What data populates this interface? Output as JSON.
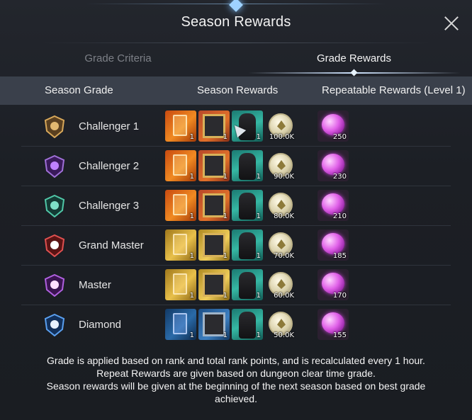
{
  "title": "Season Rewards",
  "tabs": [
    {
      "label": "Grade Criteria",
      "active": false
    },
    {
      "label": "Grade Rewards",
      "active": true
    }
  ],
  "headers": {
    "grade": "Season Grade",
    "rewards": "Season Rewards",
    "repeatable": "Repeatable Rewards (Level 1)"
  },
  "rows": [
    {
      "grade": "Challenger 1",
      "badge_color": "#b0843a",
      "item1": "1",
      "item2": "1",
      "item3": "1",
      "gold": "100.0K",
      "orbs": "250"
    },
    {
      "grade": "Challenger 2",
      "badge_color": "#7b3ab8",
      "item1": "1",
      "item2": "1",
      "item3": "1",
      "gold": "90.0K",
      "orbs": "230"
    },
    {
      "grade": "Challenger 3",
      "badge_color": "#2a9a82",
      "item1": "1",
      "item2": "1",
      "item3": "1",
      "gold": "80.0K",
      "orbs": "210"
    },
    {
      "grade": "Grand Master",
      "badge_color": "#b02a2a",
      "item1": "1",
      "item2": "1",
      "item3": "1",
      "gold": "70.0K",
      "orbs": "185"
    },
    {
      "grade": "Master",
      "badge_color": "#7a2a9a",
      "item1": "1",
      "item2": "1",
      "item3": "1",
      "gold": "60.0K",
      "orbs": "170"
    },
    {
      "grade": "Diamond",
      "badge_color": "#2a6ad0",
      "item1": "1",
      "item2": "1",
      "item3": "1",
      "gold": "50.0K",
      "orbs": "155"
    }
  ],
  "footer": {
    "line1": "Grade is applied based on rank and total rank points, and is recalculated every 1 hour.",
    "line2": "Repeat Rewards are given based on dungeon clear time grade.",
    "line3": "Season rewards will be given at the beginning of the next season based on best grade",
    "line4": "achieved."
  }
}
